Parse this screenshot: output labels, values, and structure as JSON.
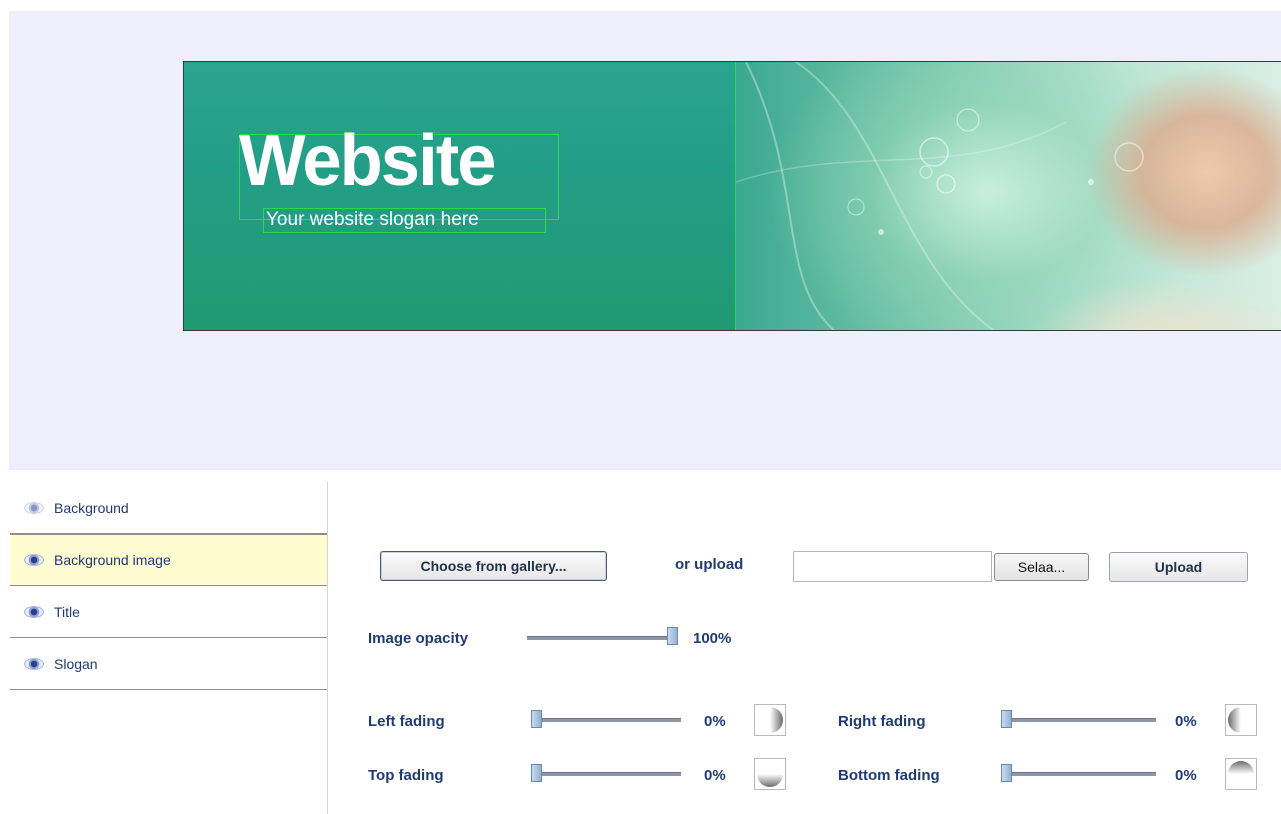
{
  "banner": {
    "title": "Website",
    "slogan": "Your website slogan here"
  },
  "sidebar": {
    "items": [
      {
        "label": "Background",
        "icon": "eye-icon",
        "active": false
      },
      {
        "label": "Background image",
        "icon": "eye-icon",
        "active": true
      },
      {
        "label": "Title",
        "icon": "eye-icon",
        "active": false
      },
      {
        "label": "Slogan",
        "icon": "eye-icon",
        "active": false
      }
    ]
  },
  "upload": {
    "gallery_button": "Choose from gallery...",
    "or_upload": "or upload",
    "file_value": "",
    "browse_button": "Selaa...",
    "upload_button": "Upload"
  },
  "opacity": {
    "label": "Image opacity",
    "value": "100%",
    "level": 1.0
  },
  "fading": {
    "left": {
      "label": "Left fading",
      "value": "0%",
      "level": 0,
      "icon": "fade-left-icon"
    },
    "right": {
      "label": "Right fading",
      "value": "0%",
      "level": 0,
      "icon": "fade-right-icon"
    },
    "top": {
      "label": "Top fading",
      "value": "0%",
      "level": 0,
      "icon": "fade-top-icon"
    },
    "bottom": {
      "label": "Bottom fading",
      "value": "0%",
      "level": 0,
      "icon": "fade-bottom-icon"
    }
  },
  "colors": {
    "label_text": "#1f3a74",
    "banner_green": "#239e86",
    "selection_outline": "#2bd94e",
    "active_item_bg": "#fefcd0"
  }
}
